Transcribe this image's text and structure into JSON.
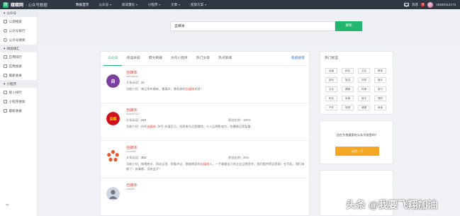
{
  "brand": {
    "logo": "窥",
    "name": "窥窥网",
    "sub": "· 公众号数据"
  },
  "nav": [
    {
      "label": "数据首页",
      "caret": false
    },
    {
      "label": "公众号",
      "caret": true
    },
    {
      "label": "阅读量化",
      "caret": true
    },
    {
      "label": "小程序",
      "caret": true
    },
    {
      "label": "文章",
      "caret": true
    },
    {
      "label": "投放方案",
      "caret": true
    }
  ],
  "topRight": {
    "messages": "消息",
    "badge": "8",
    "phone": "15830112173"
  },
  "sidebar": {
    "groups": [
      {
        "title": "公众号",
        "items": [
          "公测搜索",
          "公众号排行",
          "公众号搜索"
        ]
      },
      {
        "title": "阅读排汇",
        "items": [
          "应用排行",
          "应用搜索",
          "最新收录"
        ]
      },
      {
        "title": "小程序",
        "items": [
          "接入排行",
          "小程序搜索",
          "最新收录"
        ]
      }
    ],
    "collapse": "⇐"
  },
  "search": {
    "value": "自媒体",
    "button": "搜索"
  },
  "tabs": {
    "items": [
      "公众号",
      "阅读采排",
      "撰文刷播",
      "文内小程序",
      "热门文章",
      "热点新闻"
    ],
    "advanced": "高级搜索"
  },
  "results": [
    {
      "name": "自媒体",
      "id": "dmtdamei",
      "fans_label": "头条阅读：",
      "fans": "22",
      "intro_label": "功能介绍：",
      "intro_pre": "每日发布最新、最真实，最权威的",
      "intro_hl": "自媒体",
      "intro_post": "讯息！",
      "rate_label": "",
      "rate": ""
    },
    {
      "name": "自媒体",
      "id": "dmeet0327",
      "fans_label": "头条阅读：",
      "fans": "240",
      "intro_label": "功能介绍：",
      "intro_pre": "你的",
      "intro_hl": "自媒体",
      "intro_post": "【IP】价值百万，优质账号运营赚钱，十人品牌影响力，拍摄建运营监督",
      "rate_label": "原创比例：",
      "rate": "100%"
    },
    {
      "name": "自媒体",
      "id": "cn-zmt8",
      "fans_label": "头条阅读：",
      "fans": "302",
      "intro_label": "功能介绍：",
      "intro_pre": "微博热点、网站运营、财看评论、数据哪家的",
      "intro_hl": "自媒体",
      "intro_post": "人，一手掌握自己的企业品牌宣传，我们提供得运营段！交不起，我们来做了！有事都，没有此开！",
      "rate_label": "原创比例：",
      "rate": "23%"
    },
    {
      "name": "自媒体",
      "id": "zmt360",
      "fans_label": "",
      "fans": "",
      "intro_label": "",
      "intro_pre": "",
      "intro_hl": "",
      "intro_post": "",
      "rate_label": "",
      "rate": ""
    }
  ],
  "hotTags": {
    "title": "热门标签",
    "tags": [
      "运营",
      "网友",
      "文化",
      "教育",
      "游戏",
      "旅游",
      "体育",
      "娱乐",
      "文化",
      "健康",
      "时事",
      "旅行",
      "科技",
      "军事",
      "音乐",
      "理财",
      "汽车",
      "母婴",
      "健康",
      "美食"
    ]
  },
  "promo": {
    "text": "还在为找搜索的公众号发愁吗？",
    "button": "去招一下"
  },
  "watermark": "头条 @我要飞翔加油",
  "colors": {
    "accent": "#23b66f",
    "highlight": "#e74c3c",
    "link": "#2f78d3",
    "warning": "#f5a623",
    "topbar": "#2f3743"
  }
}
